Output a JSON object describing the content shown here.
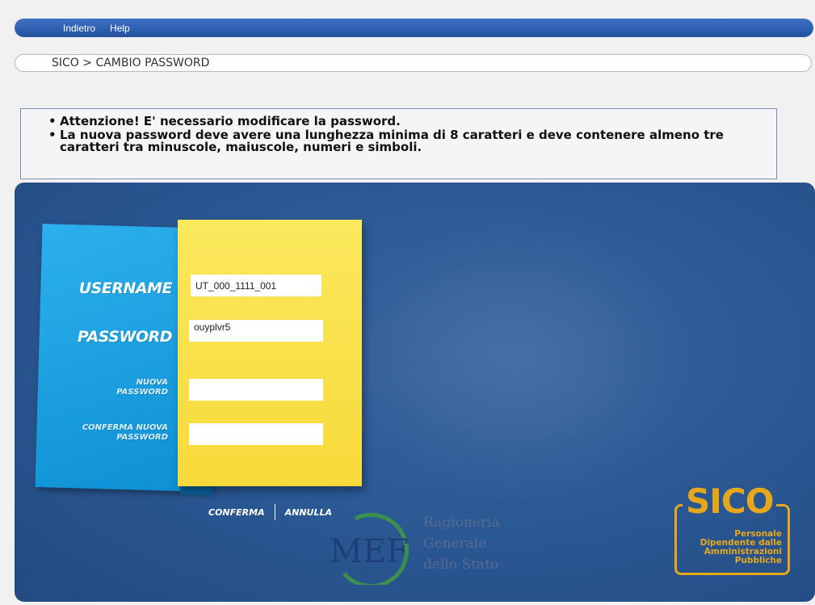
{
  "nav": {
    "back": "Indietro",
    "help": "Help"
  },
  "breadcrumb": "SICO > CAMBIO PASSWORD",
  "notice": {
    "items": [
      "Attenzione! E' necessario modificare la password.",
      "La nuova password deve avere una lunghezza minima di 8 caratteri e deve contenere almeno tre caratteri tra minuscole, maiuscole, numeri e simboli."
    ]
  },
  "form": {
    "username_label": "USERNAME",
    "username_value": "UT_000_1111_001",
    "password_label": "PASSWORD",
    "password_value": "ouyplvr5",
    "new_password_label_1": "NUOVA",
    "new_password_label_2": "PASSWORD",
    "new_password_value": "",
    "confirm_label_1": "CONFERMA NUOVA",
    "confirm_label_2": "PASSWORD",
    "confirm_value": ""
  },
  "actions": {
    "confirm": "CONFERMA",
    "cancel": "ANNULLA"
  },
  "mef": {
    "abbr": "MEF",
    "line1": "Ragioneria",
    "line2": "Generale",
    "line3": "dello Stato"
  },
  "sico": {
    "title": "SICO",
    "line1": "Personale",
    "line2": "Dipendente dalle",
    "line3": "Amministrazioni",
    "line4": "Pubbliche"
  },
  "colors": {
    "nav": "#2f61b6",
    "panel": "#2b5a95",
    "blue_note": "#1fa2e0",
    "yellow_note": "#f9e04a",
    "sico_orange": "#e7a71c"
  }
}
